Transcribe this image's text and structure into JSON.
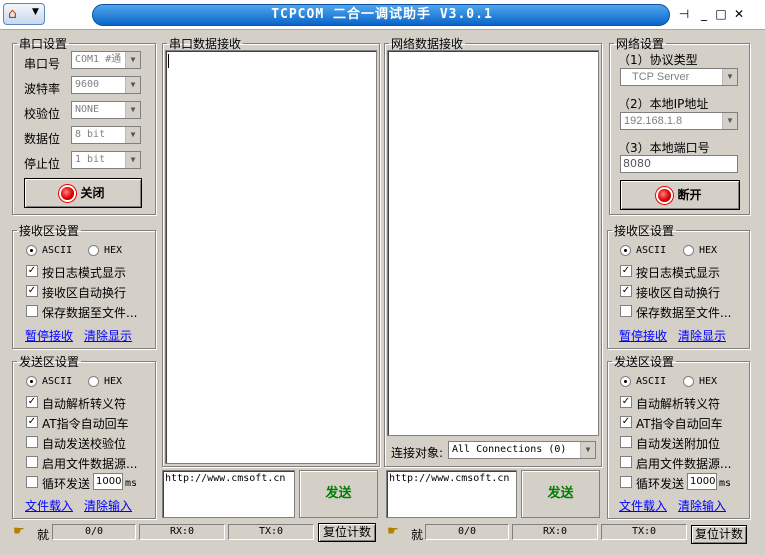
{
  "title": "TCPCOM 二合一调试助手 V3.0.1",
  "serial": {
    "legend": "串口设置",
    "port_label": "串口号",
    "port_value": "COM1 #通",
    "baud_label": "波特率",
    "baud_value": "9600",
    "parity_label": "校验位",
    "parity_value": "NONE",
    "data_label": "数据位",
    "data_value": "8 bit",
    "stop_label": "停止位",
    "stop_value": "1 bit",
    "close_btn": "关闭"
  },
  "serial_recv": {
    "legend": "串口数据接收"
  },
  "net_recv": {
    "legend": "网络数据接收",
    "conn_label": "连接对象:",
    "conn_value": "All Connections (0)"
  },
  "net": {
    "legend": "网络设置",
    "proto_label": "（1）协议类型",
    "proto_value": "TCP Server",
    "ip_label": "（2）本地IP地址",
    "ip_value": "192.168.1.8",
    "port_label": "（3）本地端口号",
    "port_value": "8080",
    "open_btn": "断开"
  },
  "left": {
    "recv": {
      "legend": "接收区设置",
      "ascii": "ASCII",
      "hex": "HEX",
      "log": "按日志模式显示",
      "wrap": "接收区自动换行",
      "save": "保存数据至文件...",
      "pause": "暂停接收",
      "clear": "清除显示"
    },
    "send": {
      "legend": "发送区设置",
      "ascii": "ASCII",
      "hex": "HEX",
      "escape": "自动解析转义符",
      "at": "AT指令自动回车",
      "auto": "自动发送校验位",
      "file": "启用文件数据源...",
      "loop": "循环发送",
      "interval": "1000",
      "ms": "ms",
      "load": "文件载入",
      "clear": "清除输入"
    },
    "input": "http://www.cmsoft.cn",
    "send_btn": "发送",
    "status": {
      "icon_text": "就",
      "count": "0/0",
      "rx": "RX:0",
      "tx": "TX:0",
      "reset": "复位计数"
    }
  },
  "right": {
    "recv": {
      "legend": "接收区设置",
      "ascii": "ASCII",
      "hex": "HEX",
      "log": "按日志模式显示",
      "wrap": "接收区自动换行",
      "save": "保存数据至文件...",
      "pause": "暂停接收",
      "clear": "清除显示"
    },
    "send": {
      "legend": "发送区设置",
      "ascii": "ASCII",
      "hex": "HEX",
      "escape": "自动解析转义符",
      "at": "AT指令自动回车",
      "auto": "自动发送附加位",
      "file": "启用文件数据源...",
      "loop": "循环发送",
      "interval": "1000",
      "ms": "ms",
      "load": "文件载入",
      "clear": "清除输入"
    },
    "input": "http://www.cmsoft.cn",
    "send_btn": "发送",
    "status": {
      "icon_text": "就",
      "count": "0/0",
      "rx": "RX:0",
      "tx": "TX:0",
      "reset": "复位计数"
    }
  },
  "window_buttons": {
    "pin": "⊣",
    "min": "_",
    "max": "□",
    "close": "✕"
  }
}
